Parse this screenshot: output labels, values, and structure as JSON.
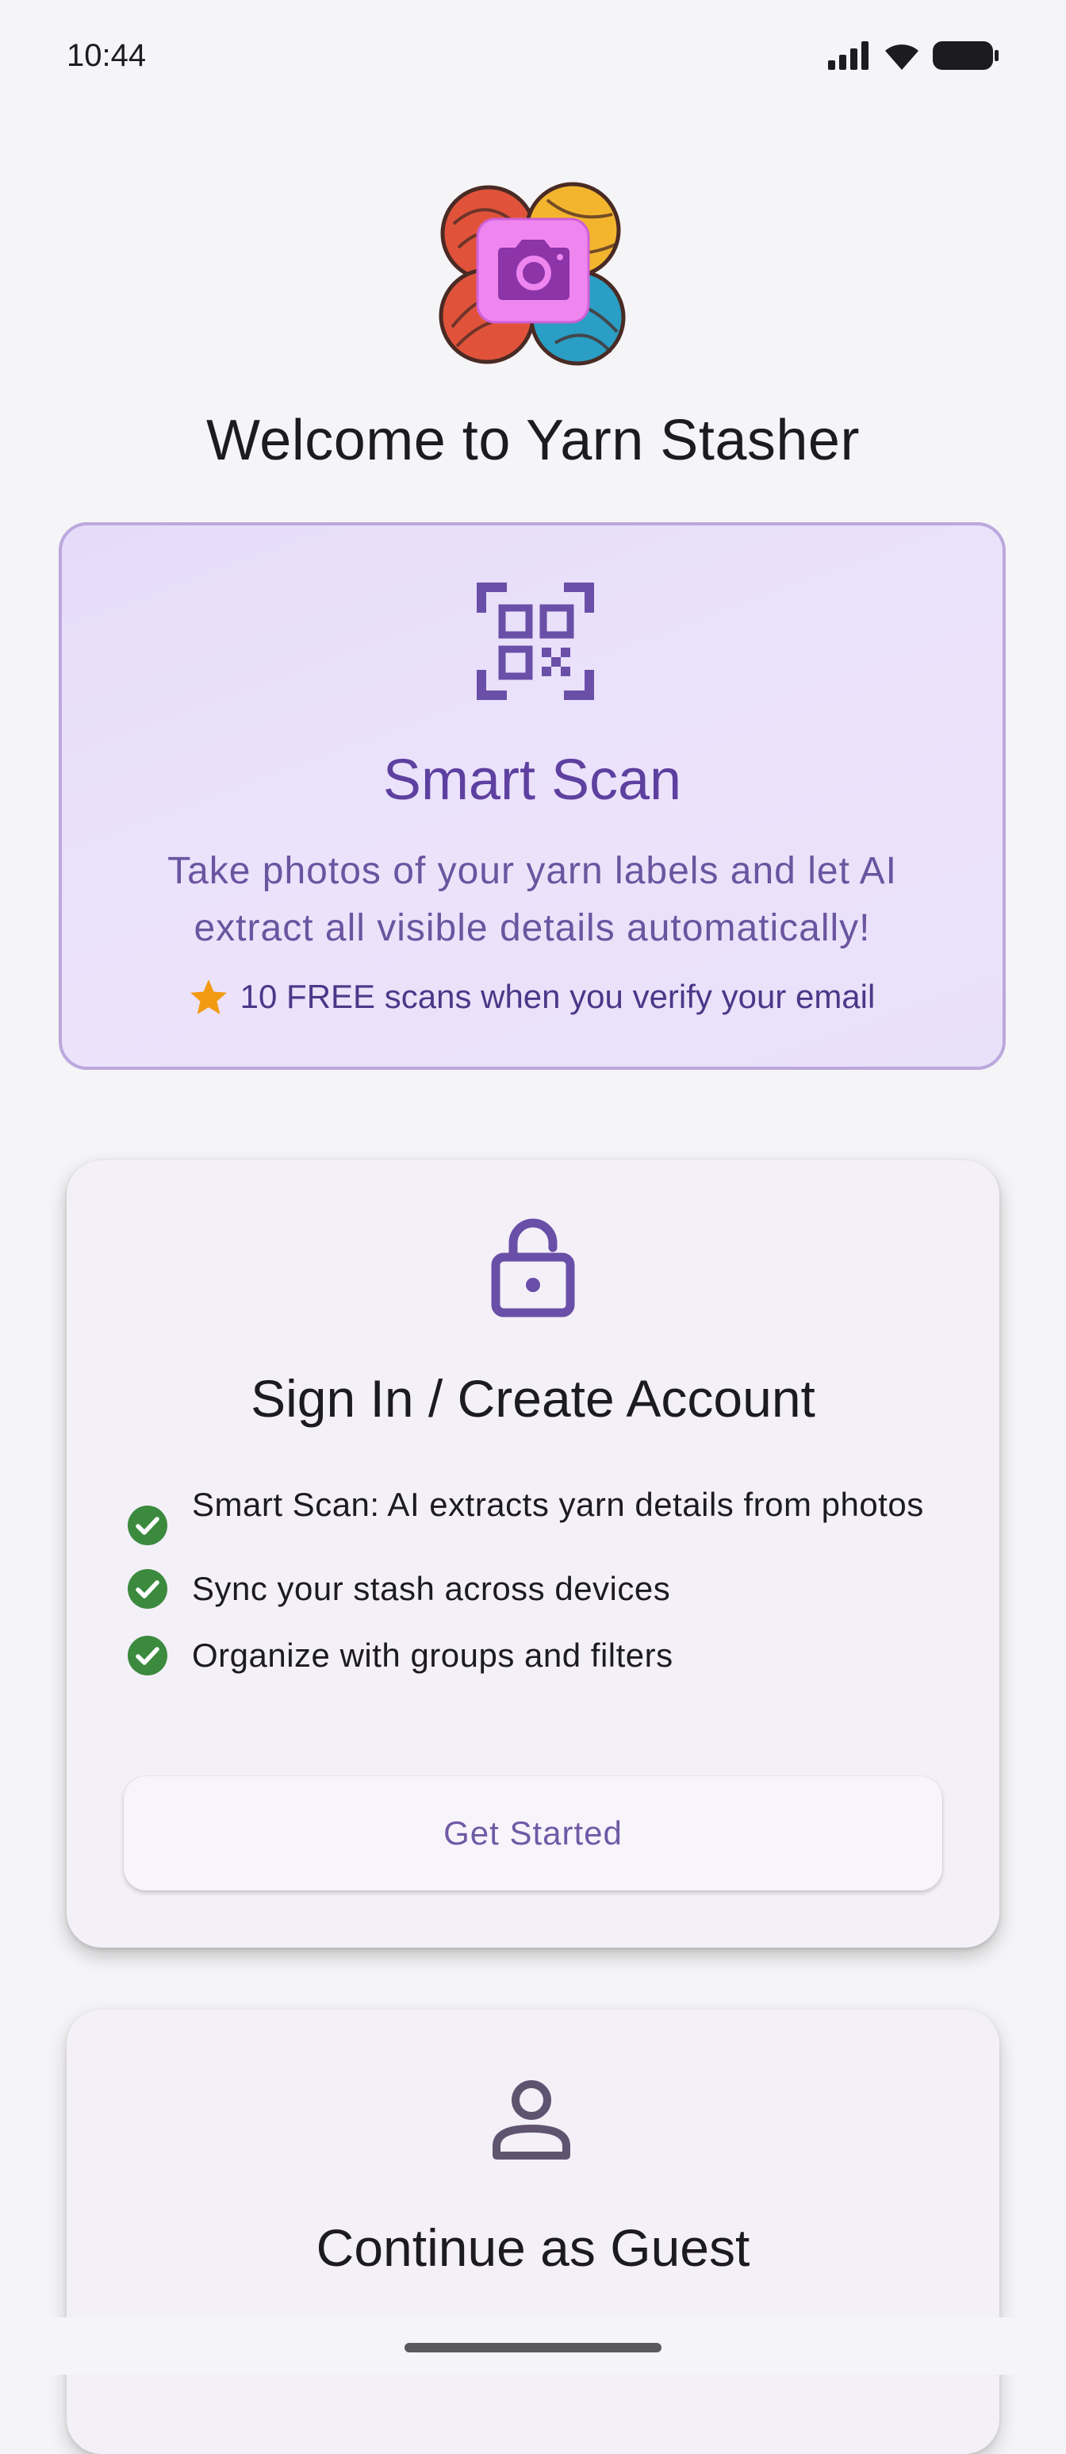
{
  "status_bar": {
    "time": "10:44"
  },
  "welcome": {
    "title": "Welcome to Yarn Stasher"
  },
  "smart_scan": {
    "title": "Smart Scan",
    "description": "Take photos of your yarn labels and let AI extract all visible details automatically!",
    "promo": "10 FREE scans when you verify your email",
    "border_color": "#bba8dc",
    "title_color": "#5e40a0"
  },
  "signin": {
    "title": "Sign In / Create Account",
    "features": [
      "Smart Scan: AI extracts yarn details from photos",
      "Sync your stash across devices",
      "Organize with groups and filters"
    ],
    "button_label": "Get Started",
    "check_color": "#3b8a3e"
  },
  "guest": {
    "title": "Continue as Guest"
  },
  "icons": {
    "logo": "yarn-camera-logo-icon",
    "smart_scan": "qr-code-scanner-icon",
    "signin": "lock-open-icon",
    "guest": "person-outline-icon",
    "promo": "star-icon",
    "feature": "check-circle-icon"
  }
}
